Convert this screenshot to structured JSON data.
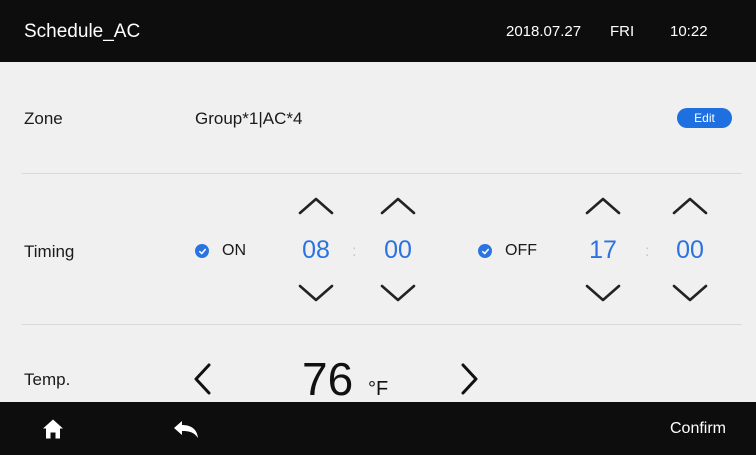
{
  "header": {
    "title": "Schedule_AC",
    "date": "2018.07.27",
    "weekday": "FRI",
    "time": "10:22"
  },
  "zone": {
    "label": "Zone",
    "value": "Group*1|AC*4",
    "edit_label": "Edit"
  },
  "timing": {
    "label": "Timing",
    "on": {
      "label": "ON",
      "hour": "08",
      "minute": "00",
      "checked": true
    },
    "off": {
      "label": "OFF",
      "hour": "17",
      "minute": "00",
      "checked": true
    },
    "separator": ":"
  },
  "temp": {
    "label": "Temp.",
    "value": "76",
    "unit": "°F"
  },
  "footer": {
    "confirm_label": "Confirm",
    "home_icon": "home-icon",
    "back_icon": "back-icon"
  },
  "colors": {
    "accent": "#2a73e0",
    "bar_bg": "#0d0d0d",
    "page_bg": "#f0f0f0"
  }
}
